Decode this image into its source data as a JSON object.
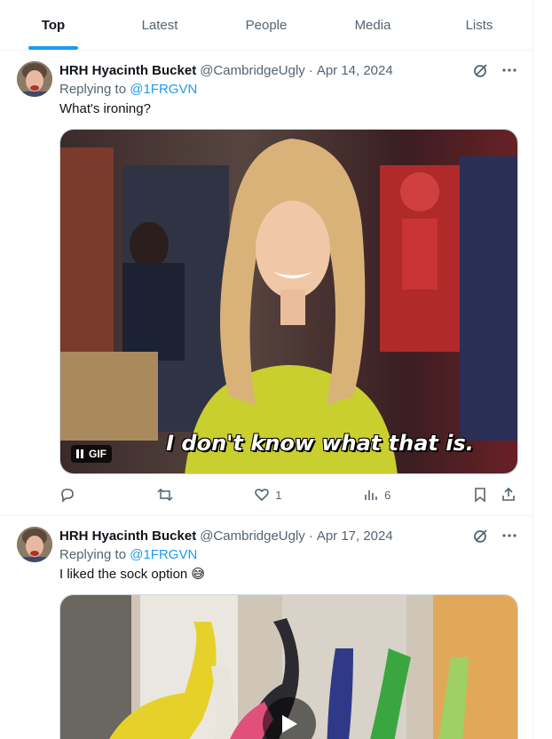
{
  "tabs": [
    {
      "label": "Top",
      "active": true
    },
    {
      "label": "Latest",
      "active": false
    },
    {
      "label": "People",
      "active": false
    },
    {
      "label": "Media",
      "active": false
    },
    {
      "label": "Lists",
      "active": false
    }
  ],
  "tweets": [
    {
      "name": "HRH Hyacinth Bucket",
      "handle": "@CambridgeUgly",
      "date": "Apr 14, 2024",
      "replying_prefix": "Replying to ",
      "replying_to": "@1FRGVN",
      "text": "What's ironing?",
      "media": {
        "type": "gif",
        "badge": "GIF",
        "caption": "I don't know what that is."
      },
      "stats": {
        "likes": "1",
        "views": "6"
      }
    },
    {
      "name": "HRH Hyacinth Bucket",
      "handle": "@CambridgeUgly",
      "date": "Apr 17, 2024",
      "replying_prefix": "Replying to ",
      "replying_to": "@1FRGVN",
      "text": "I liked the sock option 😅",
      "media": {
        "type": "video"
      }
    }
  ],
  "colors": {
    "accent": "#1d9bf0",
    "secondary_text": "#536471",
    "border": "#eff3f4"
  },
  "icons": {
    "grok": "grok-icon",
    "more": "more-icon",
    "reply": "reply-icon",
    "retweet": "retweet-icon",
    "like": "heart-icon",
    "views": "views-icon",
    "bookmark": "bookmark-icon",
    "share": "share-icon",
    "play": "play-icon",
    "pause": "pause-icon"
  }
}
